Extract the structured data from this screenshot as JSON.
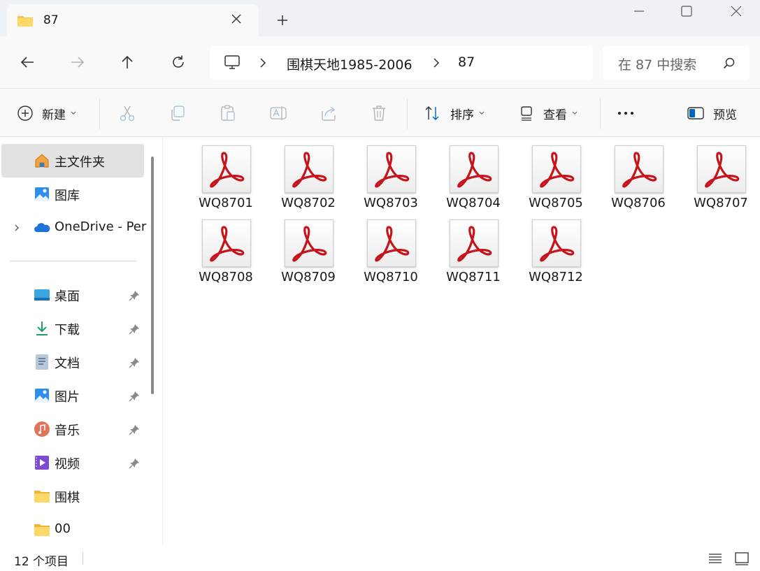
{
  "tab": {
    "title": "87"
  },
  "nav": {
    "breadcrumb": [
      "围棋天地1985-2006",
      "87"
    ],
    "search_placeholder": "在 87 中搜索"
  },
  "commands": {
    "new": "新建",
    "sort": "排序",
    "view": "查看",
    "preview": "预览"
  },
  "sidebar": {
    "items": [
      {
        "label": "主文件夹",
        "icon": "home-icon",
        "selected": true
      },
      {
        "label": "图库",
        "icon": "gallery-icon"
      },
      {
        "label": "OneDrive - Per",
        "icon": "onedrive-icon"
      },
      {
        "label": "桌面",
        "icon": "desktop-icon",
        "pinned": true
      },
      {
        "label": "下载",
        "icon": "download-icon",
        "pinned": true
      },
      {
        "label": "文档",
        "icon": "document-icon",
        "pinned": true
      },
      {
        "label": "图片",
        "icon": "pictures-icon",
        "pinned": true
      },
      {
        "label": "音乐",
        "icon": "music-icon",
        "pinned": true
      },
      {
        "label": "视频",
        "icon": "video-icon",
        "pinned": true
      },
      {
        "label": "围棋",
        "icon": "folder-icon"
      },
      {
        "label": "00",
        "icon": "folder-icon"
      }
    ]
  },
  "files": [
    {
      "name": "WQ8701",
      "type": "pdf"
    },
    {
      "name": "WQ8702",
      "type": "pdf"
    },
    {
      "name": "WQ8703",
      "type": "pdf"
    },
    {
      "name": "WQ8704",
      "type": "pdf"
    },
    {
      "name": "WQ8705",
      "type": "pdf"
    },
    {
      "name": "WQ8706",
      "type": "pdf"
    },
    {
      "name": "WQ8707",
      "type": "pdf"
    },
    {
      "name": "WQ8708",
      "type": "pdf"
    },
    {
      "name": "WQ8709",
      "type": "pdf"
    },
    {
      "name": "WQ8710",
      "type": "pdf"
    },
    {
      "name": "WQ8711",
      "type": "pdf"
    },
    {
      "name": "WQ8712",
      "type": "pdf"
    }
  ],
  "status": {
    "item_count": "12 个项目"
  },
  "colors": {
    "accent": "#0067c0",
    "pdf_red": "#c4151c",
    "folder": "#f8c44f"
  }
}
